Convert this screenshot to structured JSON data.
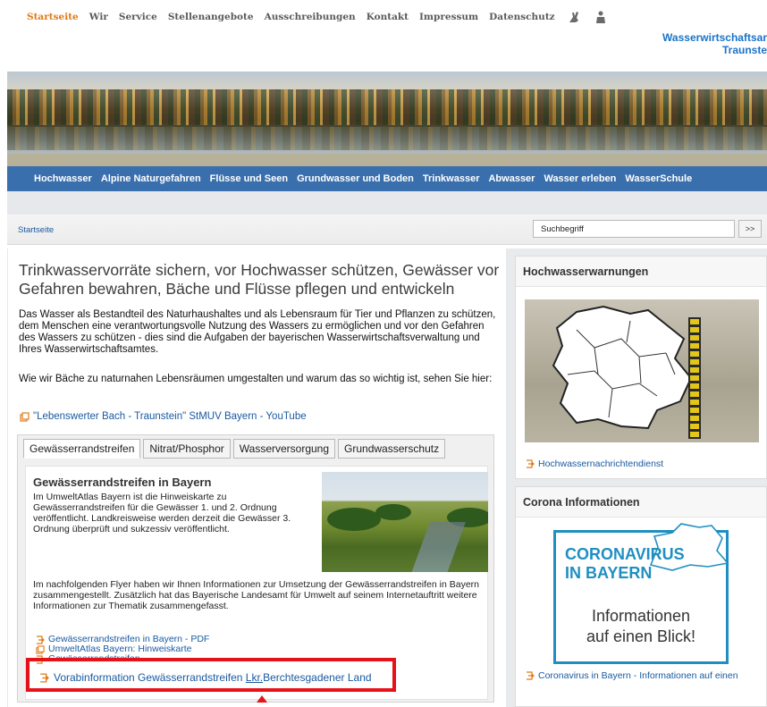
{
  "meta_nav": {
    "items": [
      "Startseite",
      "Wir",
      "Service",
      "Stellenangebote",
      "Ausschreibungen",
      "Kontakt",
      "Impressum",
      "Datenschutz"
    ],
    "icons": [
      "sign-language-icon",
      "easy-language-icon"
    ]
  },
  "brand": {
    "line1": "Wasserwirtschaftsar",
    "line2": "Traunste"
  },
  "main_nav": {
    "items": [
      "Hochwasser",
      "Alpine Naturgefahren",
      "Flüsse und Seen",
      "Grundwasser und Boden",
      "Trinkwasser",
      "Abwasser",
      "Wasser erleben",
      "WasserSchule"
    ]
  },
  "breadcrumb": "Startseite",
  "search": {
    "value": "Suchbegriff",
    "button_label": ">>"
  },
  "headline": "Trinkwasservorräte sichern, vor Hochwasser schützen, Gewässer vor Gefahren bewahren, Bäche und Flüsse pflegen und entwickeln",
  "intro": "Das Wasser als Bestandteil des Naturhaushaltes und als Lebensraum für Tier und Pflanzen zu schützen, dem Menschen eine verantwortungsvolle Nutzung des Wassers zu ermöglichen und vor den Gefahren des Wassers zu schützen - dies sind die Aufgaben der bayerischen Wasserwirtschaftsverwaltung und Ihres Wasserwirtschaftsamtes.",
  "intro2": "Wie wir Bäche zu naturnahen Lebensräumen umgestalten und warum das so wichtig ist, sehen Sie hier:",
  "video_link": "\"Lebenswerter Bach - Traunstein\" StMUV Bayern - YouTube",
  "tabs": [
    "Gewässerrandstreifen",
    "Nitrat/Phosphor",
    "Wasserversorgung",
    "Grundwasserschutz"
  ],
  "active_tab": "Gewässerrandstreifen",
  "section": {
    "title": "Gewässerrandstreifen in Bayern",
    "text1": "Im UmweltAtlas Bayern ist die Hinweiskarte zu Gewässerrandstreifen für die Gewässer 1. und 2. Ordnung veröffentlicht. Landkreisweise werden derzeit die Gewässer 3. Ordnung überprüft und sukzessiv veröffentlicht.",
    "text2": "Im nachfolgenden Flyer haben wir Ihnen Informationen zur Umsetzung der Gewässerrandstreifen in Bayern zusammengestellt. Zusätzlich hat das Bayerische Landesamt für Umwelt auf seinem Internetauftritt weitere Informationen zur Thematik zusammengefasst.",
    "links": [
      "Gewässerrandstreifen in Bayern - PDF",
      "UmweltAtlas Bayern: Hinweiskarte",
      "Gewässerrandstreifen"
    ],
    "highlight_link_pre": "Vorabinformation Gewässerrandstreifen ",
    "highlight_link_u": "Lkr.",
    "highlight_link_post": "Berchtesgadener Land"
  },
  "sidebar": {
    "flood_title": "Hochwasserwarnungen",
    "flood_link": "Hochwassernachrichtendienst",
    "corona_title": "Corona Informationen",
    "corona_headline_1": "CORONAVIRUS",
    "corona_headline_2": "IN BAYERN",
    "corona_sub_1": "Informationen",
    "corona_sub_2": "auf einen Blick!",
    "corona_link": "Coronavirus in Bayern - Informationen auf einen"
  },
  "colors": {
    "accent_orange": "#e07a18",
    "nav_blue": "#3a6fae",
    "link_blue": "#1a5aa0",
    "highlight_red": "#e5121a",
    "corona_blue": "#1f8fc1"
  }
}
